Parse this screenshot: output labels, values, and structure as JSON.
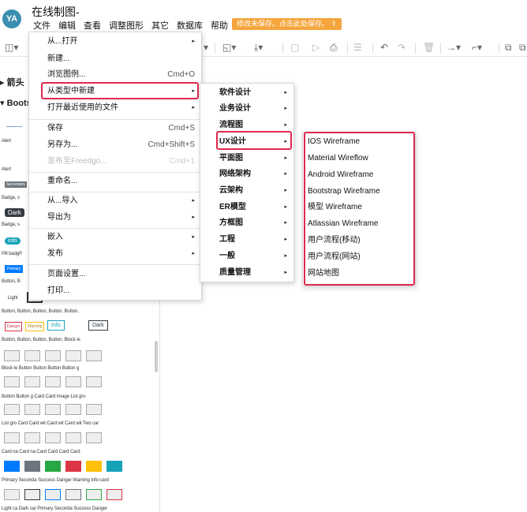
{
  "app": {
    "avatar_initials": "YA",
    "title": "在线制图-"
  },
  "menubar": [
    "文件",
    "编辑",
    "查看",
    "调整图形",
    "其它",
    "数据库",
    "帮助"
  ],
  "save_warning": "修改未保存。点击此处保存。",
  "sidebar": {
    "section_arrow": "箭头",
    "section_boots": "Boots",
    "rows": [
      "Alert",
      "Alert",
      "Badge, s",
      "Badge, s",
      "Pill badgP",
      "Button, B",
      "Light",
      "Button, Button, Button, Button, Button,",
      "Button, Button, Button, Button, Block le",
      "Block le Button Button Button Button g",
      "Button Button g Card  Card  Image  List gro",
      "List gro  Card  Card wit Card wit Card wit Two car",
      "Card na Card na Card  Card  Card  Card",
      "Primary Seconda Success Danger Warning Info card",
      "Light ca Dark car Primary Seconda Success Danger"
    ],
    "badges": {
      "secondary": "Secondary",
      "dark": "Dark",
      "info": "Info",
      "primary": "Primary",
      "danger": "Danger",
      "warning": "Warning",
      "info2": "Info",
      "dark2": "Dark"
    }
  },
  "file_menu": {
    "items": [
      {
        "label": "从...打开",
        "arrow": "▸"
      },
      {
        "label": "新建..."
      },
      {
        "label": "浏览图例...",
        "shortcut": "Cmd+O"
      },
      {
        "label": "从类型中新建",
        "arrow": "▸"
      },
      {
        "label": "打开最近使用的文件",
        "arrow": "▸"
      },
      {
        "label": "保存",
        "shortcut": "Cmd+S"
      },
      {
        "label": "另存为...",
        "shortcut": "Cmd+Shift+S"
      },
      {
        "label": "发布至Freedgo...",
        "shortcut": "Cmd+1"
      },
      {
        "label": "重命名..."
      },
      {
        "label": "从...导入",
        "arrow": "▸"
      },
      {
        "label": "导出为",
        "arrow": "▸"
      },
      {
        "label": "嵌入",
        "arrow": "▸"
      },
      {
        "label": "发布",
        "arrow": "▸"
      },
      {
        "label": "页面设置..."
      },
      {
        "label": "打印..."
      }
    ]
  },
  "type_menu": {
    "items": [
      "软件设计",
      "业务设计",
      "流程图",
      "UX设计",
      "平面图",
      "网络架构",
      "云架构",
      "ER模型",
      "方框图",
      "工程",
      "一般",
      "质量管理"
    ],
    "arrow": "▸"
  },
  "ux_menu": {
    "items": [
      "IOS Wireframe",
      "Material Wireflow",
      "Android Wireframe",
      "Bootstrap Wireframe",
      "模型 Wireframe",
      "Atlassian Wireframe",
      "用户流程(移动)",
      "用户流程(网站)",
      "网站地图"
    ]
  },
  "colors": {
    "highlight": "#e0294e",
    "warning": "#f4a53c",
    "avatar": "#3b8fb0"
  }
}
